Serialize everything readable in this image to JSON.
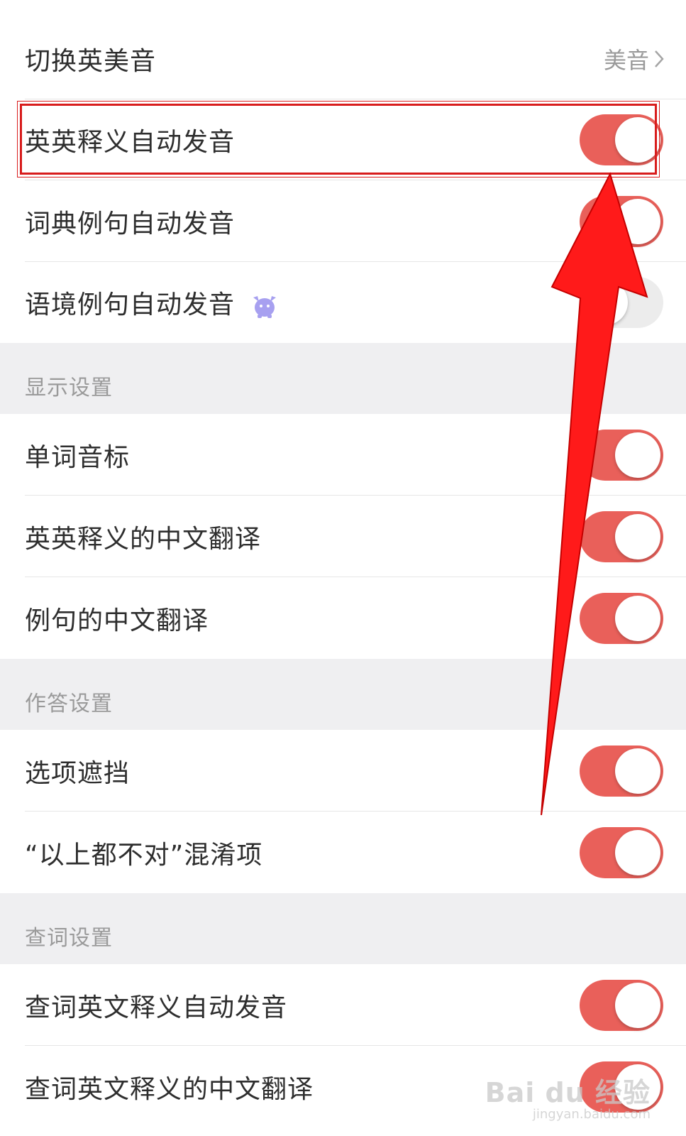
{
  "rows": {
    "switch_accent": {
      "label": "切换英美音",
      "value": "美音"
    },
    "en_def_auto_pronounce": {
      "label": "英英释义自动发音",
      "enabled": true
    },
    "dict_example_auto_pronounce": {
      "label": "词典例句自动发音",
      "enabled": true
    },
    "context_example_auto_pronounce": {
      "label": "语境例句自动发音",
      "enabled": false,
      "badge_icon": "mascot-icon"
    },
    "word_phonetic": {
      "label": "单词音标",
      "enabled": true
    },
    "en_def_cn_translation": {
      "label": "英英释义的中文翻译",
      "enabled": true
    },
    "example_cn_translation": {
      "label": "例句的中文翻译",
      "enabled": true
    },
    "option_mask": {
      "label": "选项遮挡",
      "enabled": true
    },
    "none_correct_distractor": {
      "label": "“以上都不对”混淆项",
      "enabled": true
    },
    "lookup_en_def_auto_pronounce": {
      "label": "查词英文释义自动发音",
      "enabled": true
    },
    "lookup_en_def_cn_translation": {
      "label": "查词英文释义的中文翻译",
      "enabled": true
    }
  },
  "sections": {
    "display": "显示设置",
    "answer": "作答设置",
    "lookup": "查词设置"
  },
  "colors": {
    "toggle_on": "#e9605a",
    "toggle_off": "#ececec",
    "section_bg": "#efeff1",
    "highlight": "#d81c1c",
    "arrow": "#ff1a1a"
  },
  "watermark": {
    "logo": "Bai du 经验",
    "url": "jingyan.baidu.com"
  }
}
